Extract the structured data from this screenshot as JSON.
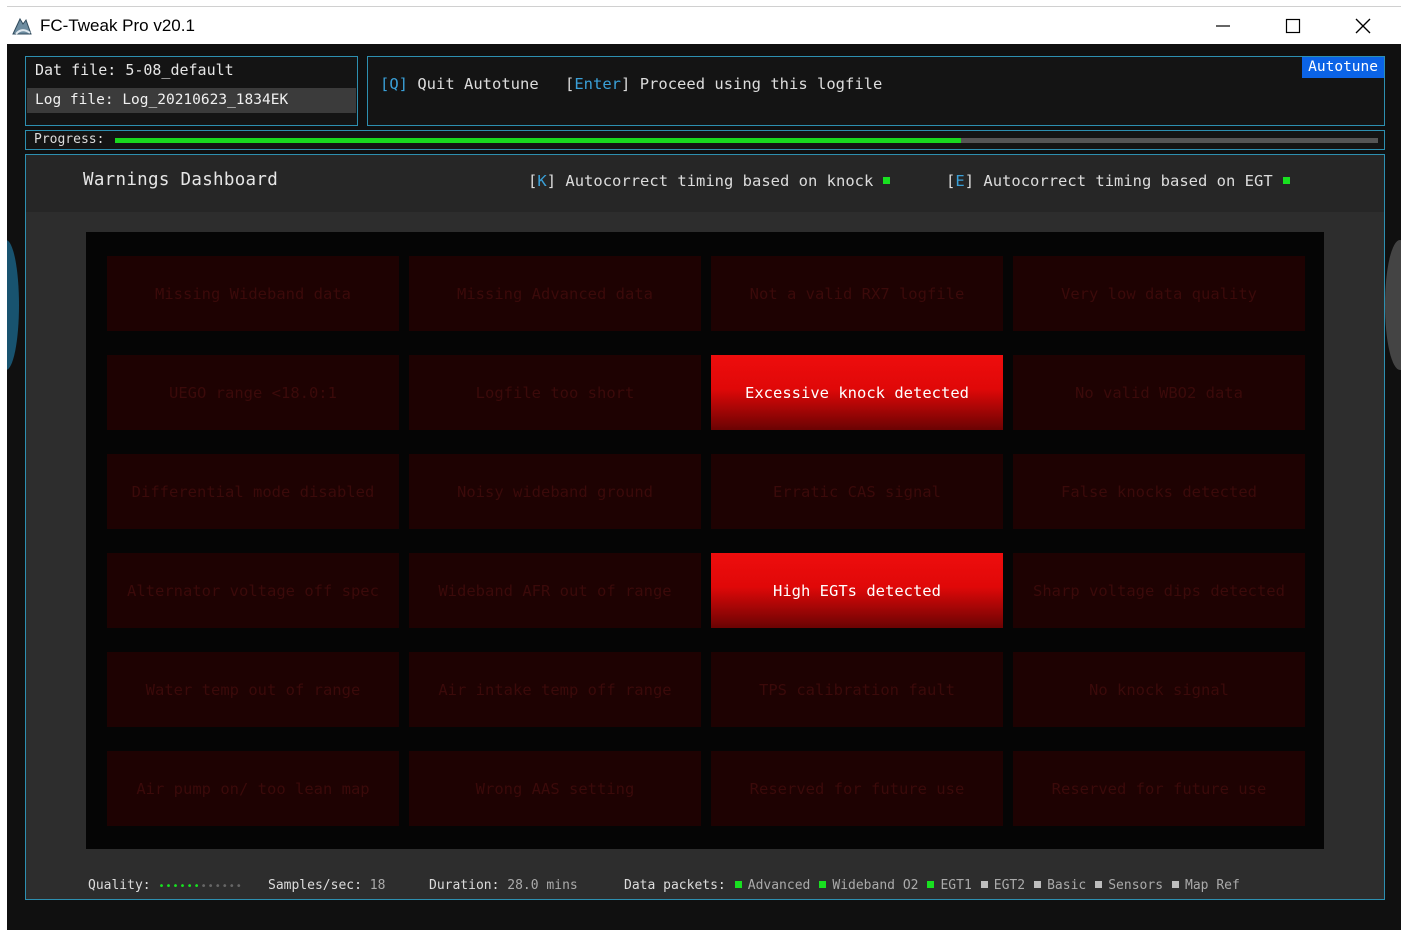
{
  "window": {
    "title": "FC-Tweak Pro v20.1",
    "controls": [
      "minimize-icon",
      "maximize-icon",
      "close-icon"
    ]
  },
  "files": {
    "dat_label": "Dat file:",
    "dat_value": "5-08_default",
    "log_label": "Log file:",
    "log_value": "Log_20210623_1834EK"
  },
  "commands": {
    "quit_key": "[Q]",
    "quit_label": "Quit Autotune",
    "proceed_key_open": "[",
    "proceed_key": "Enter",
    "proceed_key_close": "]",
    "proceed_label": "Proceed using this logfile",
    "mode_badge": "Autotune"
  },
  "progress": {
    "label": "Progress:",
    "value": 0.67
  },
  "dashboard": {
    "title": "Warnings Dashboard",
    "knock_key_open": "[",
    "knock_key": "K",
    "knock_key_close": "]",
    "knock_label": "Autocorrect timing based on knock",
    "knock_enabled": true,
    "egt_key_open": "[",
    "egt_key": "E",
    "egt_key_close": "]",
    "egt_label": "Autocorrect timing based on EGT",
    "egt_enabled": true,
    "warnings": [
      {
        "label": "Missing Wideband data",
        "active": false
      },
      {
        "label": "Missing Advanced data",
        "active": false
      },
      {
        "label": "Not a valid RX7 logfile",
        "active": false
      },
      {
        "label": "Very low data quality",
        "active": false
      },
      {
        "label": "UEGO range <18.0:1",
        "active": false
      },
      {
        "label": "Logfile too short",
        "active": false
      },
      {
        "label": "Excessive knock detected",
        "active": true
      },
      {
        "label": "No valid WBO2 data",
        "active": false
      },
      {
        "label": "Differential mode disabled",
        "active": false
      },
      {
        "label": "Noisy wideband ground",
        "active": false
      },
      {
        "label": "Erratic CAS signal",
        "active": false
      },
      {
        "label": "False knocks detected",
        "active": false
      },
      {
        "label": "Alternator voltage off spec",
        "active": false
      },
      {
        "label": "Wideband AFR out of range",
        "active": false
      },
      {
        "label": "High EGTs detected",
        "active": true
      },
      {
        "label": "Sharp voltage dips detected",
        "active": false
      },
      {
        "label": "Water temp out of range",
        "active": false
      },
      {
        "label": "Air intake temp off range",
        "active": false
      },
      {
        "label": "TPS calibration fault",
        "active": false
      },
      {
        "label": "No knock signal",
        "active": false
      },
      {
        "label": "Air pump on/ too lean map",
        "active": false
      },
      {
        "label": "Wrong AAS setting",
        "active": false
      },
      {
        "label": "Reserved for future use",
        "active": false
      },
      {
        "label": "Reserved for future use",
        "active": false
      }
    ]
  },
  "status": {
    "quality_label": "Quality:",
    "quality_level": 6,
    "quality_max": 12,
    "samples_label": "Samples/sec:",
    "samples_value": "18",
    "duration_label": "Duration:",
    "duration_value": "28.0 mins",
    "packets_label": "Data packets:",
    "packets": [
      {
        "name": "Advanced",
        "active": true
      },
      {
        "name": "Wideband O2",
        "active": true
      },
      {
        "name": "EGT1",
        "active": true
      },
      {
        "name": "EGT2",
        "active": false
      },
      {
        "name": "Basic",
        "active": false
      },
      {
        "name": "Sensors",
        "active": false
      },
      {
        "name": "Map Ref",
        "active": false
      }
    ]
  },
  "colors": {
    "accent_border": "#2d8fb0",
    "key_highlight": "#3aa0d8",
    "mode_badge": "#0b63e6",
    "active_green": "#18e020",
    "inactive_packet": "#bdbdbd",
    "warning_active": "#ee0d0d",
    "warning_inactive": "#1e0202"
  }
}
